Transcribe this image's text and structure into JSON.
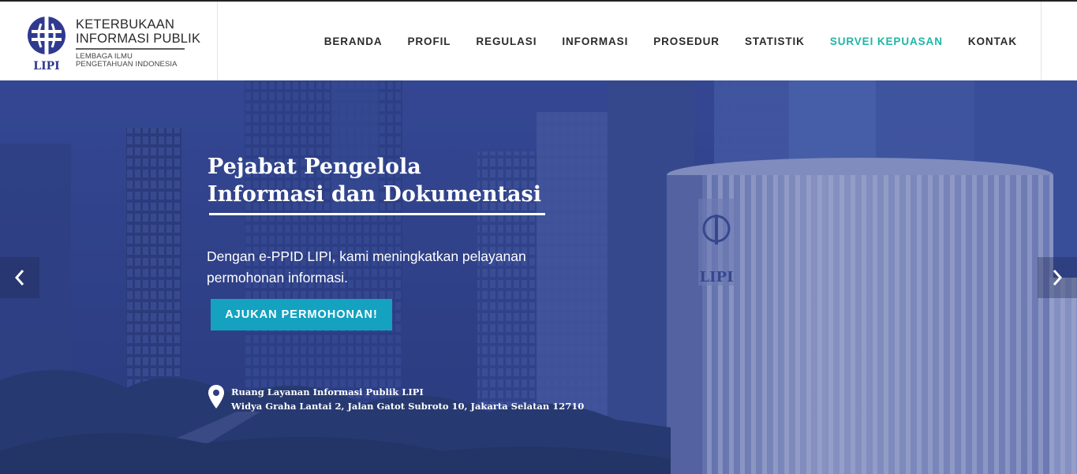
{
  "brand": {
    "title_line1": "KETERBUKAAN",
    "title_line2": "INFORMASI PUBLIK",
    "sub_line1": "LEMBAGA ILMU",
    "sub_line2": "PENGETAHUAN INDONESIA",
    "emblem_label": "LIPI",
    "emblem_color": "#2f3a8f"
  },
  "nav": {
    "items": [
      {
        "label": "BERANDA"
      },
      {
        "label": "PROFIL"
      },
      {
        "label": "REGULASI"
      },
      {
        "label": "INFORMASI"
      },
      {
        "label": "PROSEDUR"
      },
      {
        "label": "STATISTIK"
      },
      {
        "label": "SURVEI KEPUASAN",
        "active": true
      },
      {
        "label": "KONTAK"
      }
    ],
    "active_color": "#1fb5a6"
  },
  "hero": {
    "title_line1": "Pejabat Pengelola",
    "title_line2": "Informasi dan Dokumentasi",
    "description_line1": "Dengan e-PPID LIPI, kami meningkatkan pelayanan",
    "description_line2": "permohonan informasi.",
    "cta_label": "AJUKAN PERMOHONAN!",
    "cta_color": "#14a2c0",
    "location_title": "Ruang Layanan Informasi Publik LIPI",
    "location_address": "Widya Graha Lantai 2, Jalan Gatot Subroto 10, Jakarta Selatan 12710",
    "location_icon": "map-pin-icon",
    "building_sign": "LIPI"
  },
  "slider": {
    "prev_icon": "chevron-left-icon",
    "next_icon": "chevron-right-icon"
  }
}
